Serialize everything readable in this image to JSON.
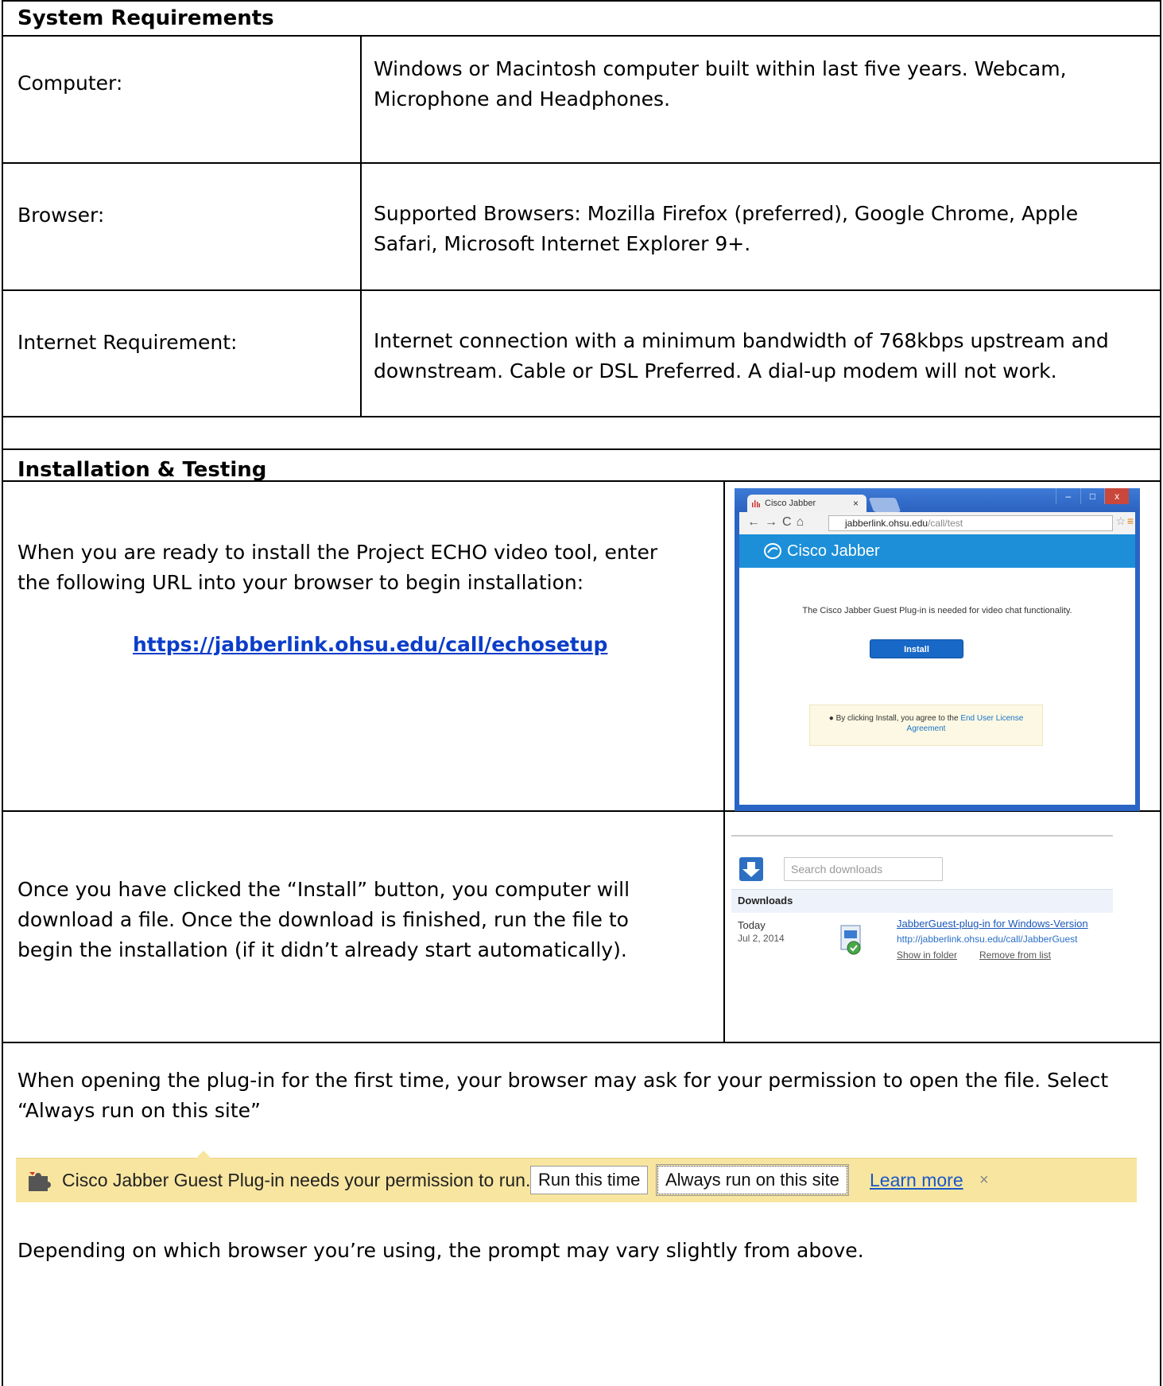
{
  "system_requirements": {
    "heading": "System Requirements",
    "rows": [
      {
        "label": "Computer:",
        "lines": [
          "Windows or Macintosh computer built within last five years. Webcam,",
          "Microphone and Headphones."
        ]
      },
      {
        "label": "Browser:",
        "lines": [
          "Supported Browsers: Mozilla Firefox (preferred), Google Chrome, Apple",
          "Safari, Microsoft Internet Explorer 9+."
        ]
      },
      {
        "label": "Internet Requirement:",
        "lines": [
          "Internet connection with a minimum bandwidth of 768kbps upstream and",
          "downstream. Cable or DSL Preferred. A dial-up modem will not work."
        ]
      }
    ]
  },
  "installation": {
    "heading": "Installation & Testing",
    "step1": {
      "lines": [
        "When you are ready to install the Project ECHO video tool, enter",
        "the following URL into your browser to begin installation:"
      ],
      "url": "https://jabberlink.ohsu.edu/call/echosetup"
    },
    "step2": {
      "lines": [
        "Once you have clicked the “Install” button, you computer will",
        "download a file. Once the download is finished, run the file to",
        "begin the installation (if it didn’t already start automatically)."
      ]
    },
    "step3": {
      "lines": [
        "When opening the plug-in for the first time, your browser may ask for your permission to open the file. Select",
        "“Always run on this site”"
      ],
      "footer": "Depending on which browser you’re using, the prompt may vary slightly from above."
    }
  },
  "jabber_window": {
    "tab_title": "Cisco Jabber",
    "tab_close": "×",
    "win_min": "–",
    "win_max": "□",
    "win_close": "x",
    "nav_glyphs": "←→C⌂",
    "address_host": "jabberlink.ohsu.edu",
    "address_path": "/call/test",
    "brand": "Cisco Jabber",
    "message": "The Cisco Jabber Guest Plug-in is needed for video chat functionality.",
    "install_button": "Install",
    "notice_prefix": "By clicking Install, you agree to the",
    "notice_link1": "End User License",
    "notice_link2": "Agreement",
    "info_icon": "●"
  },
  "downloads_page": {
    "search_placeholder": "Search downloads",
    "title": "Downloads",
    "day": "Today",
    "date": "Jul 2, 2014",
    "file_name": "JabberGuest-plug-in for Windows-Version",
    "file_url": "http://jabberlink.ohsu.edu/call/JabberGuest",
    "show_in_folder": "Show in folder",
    "remove_from_list": "Remove from list"
  },
  "permission_bar": {
    "message": "Cisco Jabber Guest Plug-in needs your permission to run.",
    "run_once": "Run this time",
    "always_run": "Always run on this site",
    "learn_more": "Learn more",
    "close": "×"
  },
  "colors": {
    "link": "#0b3dc8",
    "jabber_blue": "#1c8fd8",
    "install_blue": "#1868c8",
    "permission_yellow": "#f8e6a0"
  }
}
